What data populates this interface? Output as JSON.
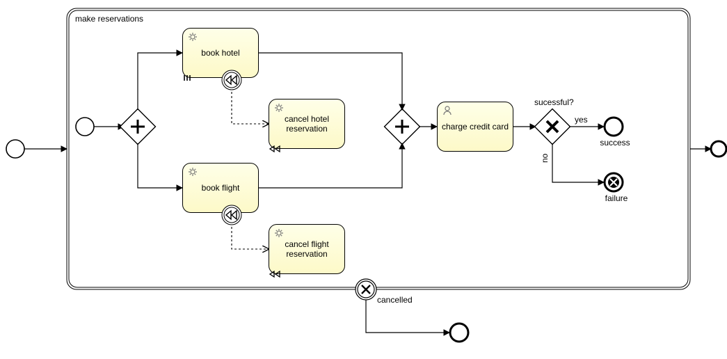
{
  "process": {
    "subprocess_title": "make reservations",
    "tasks": {
      "book_hotel": "book hotel",
      "cancel_hotel": "cancel hotel reservation",
      "book_flight": "book flight",
      "cancel_flight": "cancel flight reservation",
      "charge_card": "charge credit card"
    },
    "gateways": {
      "decision_label": "sucessful?"
    },
    "edges": {
      "yes": "yes",
      "no": "no"
    },
    "events": {
      "success": "success",
      "failure": "failure",
      "cancelled": "cancelled"
    }
  }
}
